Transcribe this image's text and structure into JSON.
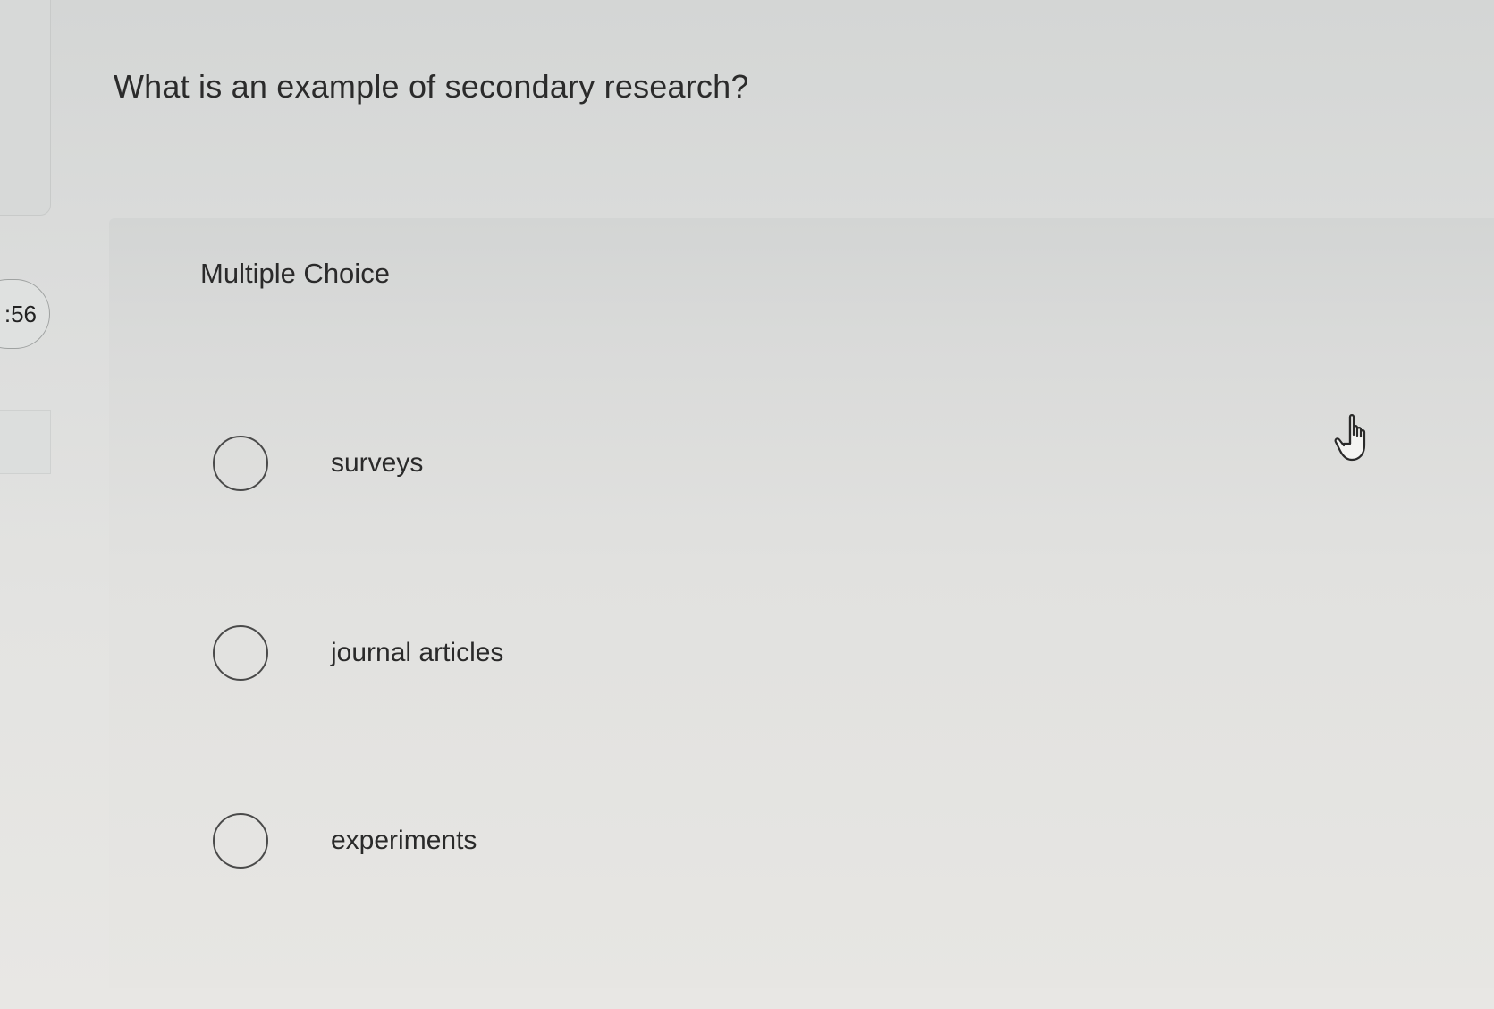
{
  "timer": {
    "text": ":56"
  },
  "question": {
    "text": "What is an example of secondary research?"
  },
  "choice_type": {
    "label": "Multiple Choice"
  },
  "options": [
    {
      "label": "surveys"
    },
    {
      "label": "journal articles"
    },
    {
      "label": "experiments"
    }
  ],
  "icons": {
    "pointer": "hand-pointer-icon",
    "radio": "radio-circle-icon"
  },
  "colors": {
    "background": "#dcdddc",
    "text": "#2a2a2a",
    "radio_border": "#4a4a4a"
  }
}
